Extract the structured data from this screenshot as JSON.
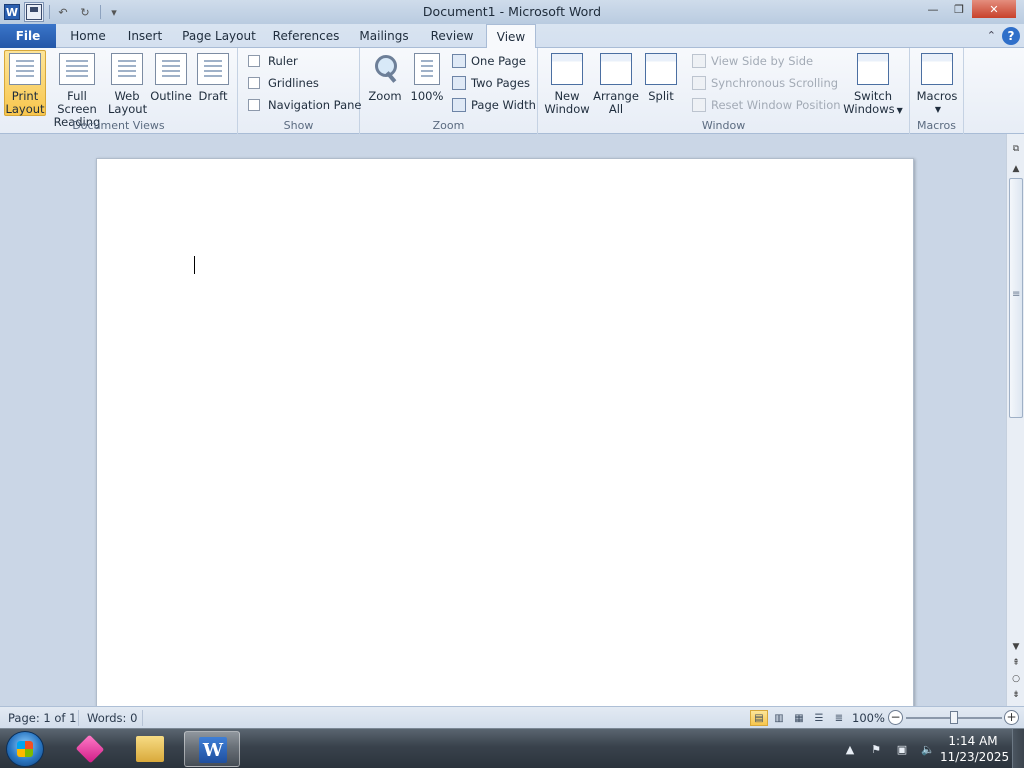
{
  "window": {
    "title": "Document1 - Microsoft Word",
    "app_icon_letter": "W",
    "minimize": "—",
    "restore": "❐",
    "close": "✕"
  },
  "qat": {
    "undo": "↶",
    "redo": "↻",
    "customize": "▾"
  },
  "tabs": {
    "file": "File",
    "items": [
      "Home",
      "Insert",
      "Page Layout",
      "References",
      "Mailings",
      "Review",
      "View"
    ],
    "active": "View",
    "minimize_ribbon": "⌃",
    "help": "?"
  },
  "ribbon": {
    "document_views": {
      "label": "Document Views",
      "print_layout": [
        "Print",
        "Layout"
      ],
      "full_screen_reading": [
        "Full Screen",
        "Reading"
      ],
      "web_layout": [
        "Web",
        "Layout"
      ],
      "outline": "Outline",
      "draft": "Draft"
    },
    "show": {
      "label": "Show",
      "ruler": "Ruler",
      "gridlines": "Gridlines",
      "navigation_pane": "Navigation Pane"
    },
    "zoom": {
      "label": "Zoom",
      "zoom": "Zoom",
      "hundred": "100%",
      "one_page": "One Page",
      "two_pages": "Two Pages",
      "page_width": "Page Width"
    },
    "window": {
      "label": "Window",
      "new_window": [
        "New",
        "Window"
      ],
      "arrange_all": [
        "Arrange",
        "All"
      ],
      "split": "Split",
      "view_side_by_side": "View Side by Side",
      "synchronous_scrolling": "Synchronous Scrolling",
      "reset_window_position": "Reset Window Position",
      "switch_windows": [
        "Switch",
        "Windows"
      ]
    },
    "macros": {
      "label": "Macros",
      "macros": "Macros"
    }
  },
  "statusbar": {
    "page": "Page: 1 of 1",
    "words": "Words: 0",
    "zoom_level": "100%",
    "zoom_minus": "−",
    "zoom_plus": "+"
  },
  "taskbar": {
    "word_letter": "W",
    "time": "1:14 AM",
    "date": "11/23/2025",
    "tray_expand": "▲"
  }
}
